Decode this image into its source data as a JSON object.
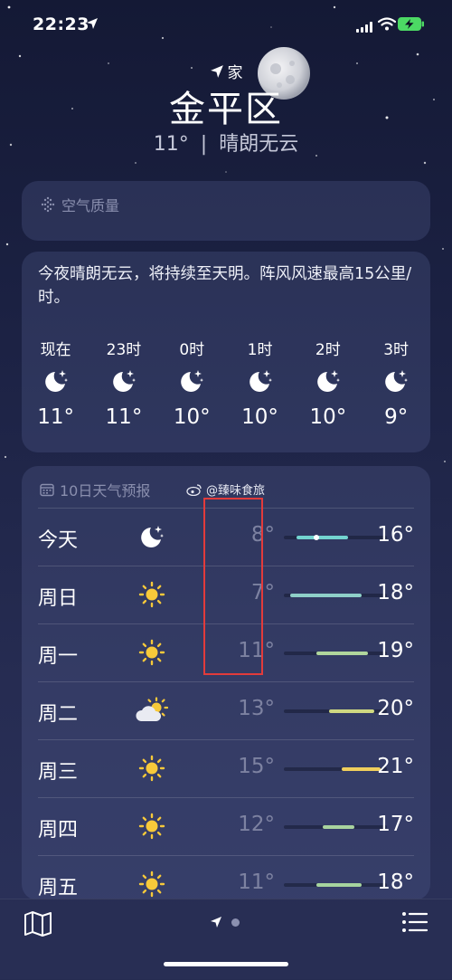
{
  "status": {
    "time": "22:23"
  },
  "header": {
    "home_label": "家",
    "city": "金平区",
    "temp": "11°",
    "divider": "|",
    "condition": "晴朗无云"
  },
  "air_quality": {
    "title": "空气质量"
  },
  "hourly": {
    "description": "今夜晴朗无云，将持续至天明。阵风风速最高15公里/时。",
    "hours": [
      {
        "label": "现在",
        "icon": "moon-stars-icon",
        "temp": "11°"
      },
      {
        "label": "23时",
        "icon": "moon-stars-icon",
        "temp": "11°"
      },
      {
        "label": "0时",
        "icon": "moon-stars-icon",
        "temp": "10°"
      },
      {
        "label": "1时",
        "icon": "moon-stars-icon",
        "temp": "10°"
      },
      {
        "label": "2时",
        "icon": "moon-stars-icon",
        "temp": "10°"
      },
      {
        "label": "3时",
        "icon": "moon-stars-icon",
        "temp": "9°"
      }
    ]
  },
  "daily": {
    "title": "10日天气预报",
    "watermark": "@臻味食旅",
    "days": [
      {
        "day": "今天",
        "icon": "moon-stars-icon",
        "low": "8°",
        "high": "16°",
        "range": [
          8,
          16
        ],
        "current": 11,
        "color": "#73d4d0"
      },
      {
        "day": "周日",
        "icon": "sun-icon",
        "low": "7°",
        "high": "18°",
        "range": [
          7,
          18
        ],
        "color": "#8fd0c8"
      },
      {
        "day": "周一",
        "icon": "sun-icon",
        "low": "11°",
        "high": "19°",
        "range": [
          11,
          19
        ],
        "color": "#b0d69c"
      },
      {
        "day": "周二",
        "icon": "cloud-sun-icon",
        "low": "13°",
        "high": "20°",
        "range": [
          13,
          20
        ],
        "color": "#cfd881"
      },
      {
        "day": "周三",
        "icon": "sun-icon",
        "low": "15°",
        "high": "21°",
        "range": [
          15,
          21
        ],
        "color": "#f0cf5c"
      },
      {
        "day": "周四",
        "icon": "sun-icon",
        "low": "12°",
        "high": "17°",
        "range": [
          12,
          17
        ],
        "color": "#a9d39e"
      },
      {
        "day": "周五",
        "icon": "sun-icon",
        "low": "11°",
        "high": "18°",
        "range": [
          11,
          18
        ],
        "color": "#a6d49e"
      }
    ],
    "scale": [
      6,
      22
    ]
  }
}
